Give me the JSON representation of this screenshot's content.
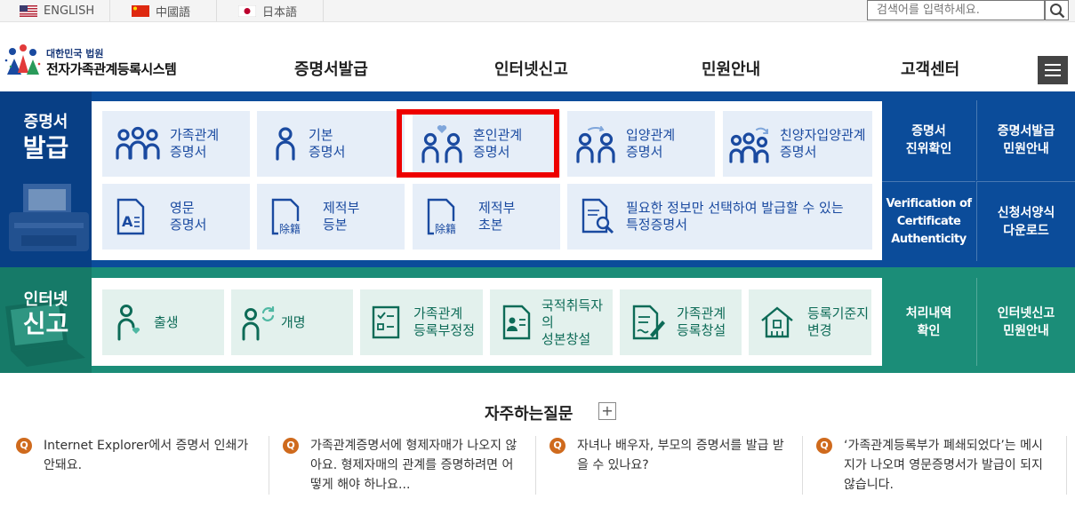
{
  "top_bar": {
    "languages": [
      {
        "label": "ENGLISH"
      },
      {
        "label": "中國語"
      },
      {
        "label": "日本語"
      }
    ],
    "search_placeholder": "검색어를 입력하세요."
  },
  "logo": {
    "sub": "대한민국 법원",
    "main": "전자가족관계등록시스템"
  },
  "gnb": [
    "증명서발급",
    "인터넷신고",
    "민원안내",
    "고객센터"
  ],
  "certificate": {
    "title_small": "증명서",
    "title_large": "발급",
    "tiles": [
      {
        "line1": "가족관계",
        "line2": "증명서",
        "icon": "family-icon"
      },
      {
        "line1": "기본",
        "line2": "증명서",
        "icon": "person-icon"
      },
      {
        "line1": "혼인관계",
        "line2": "증명서",
        "icon": "marriage-icon"
      },
      {
        "line1": "입양관계",
        "line2": "증명서",
        "icon": "adoption-icon"
      },
      {
        "line1": "친양자입양관계",
        "line2": "증명서",
        "icon": "full-adoption-icon"
      },
      {
        "line1": "영문",
        "line2": "증명서",
        "icon": "english-doc-icon"
      },
      {
        "line1": "제적부",
        "line2": "등본",
        "icon": "removed-register-icon"
      },
      {
        "line1": "제적부",
        "line2": "초본",
        "icon": "removed-register-icon"
      },
      {
        "line1": "필요한 정보만 선택하여 발급할 수 있는",
        "line2": "특정증명서",
        "icon": "doc-search-icon"
      }
    ],
    "stamp_text": "除籍",
    "right": [
      {
        "line1": "증명서",
        "line2": "진위확인"
      },
      {
        "line1": "증명서발급",
        "line2": "민원안내"
      },
      {
        "line1": "Verification of",
        "line2": "Certificate",
        "line3": "Authenticity"
      },
      {
        "line1": "신청서양식",
        "line2": "다운로드"
      }
    ]
  },
  "internet_report": {
    "title_small": "인터넷",
    "title_large": "신고",
    "tiles": [
      {
        "line1": "출생",
        "line2": "",
        "icon": "birth-icon"
      },
      {
        "line1": "개명",
        "line2": "",
        "icon": "rename-icon"
      },
      {
        "line1": "가족관계",
        "line2": "등록부정정",
        "icon": "checklist-icon"
      },
      {
        "line1": "국적취득자의",
        "line2": "성본창설",
        "icon": "id-card-icon"
      },
      {
        "line1": "가족관계",
        "line2": "등록창설",
        "icon": "doc-pen-icon"
      },
      {
        "line1": "등록기준지",
        "line2": "변경",
        "icon": "house-icon"
      }
    ],
    "right": [
      {
        "line1": "처리내역",
        "line2": "확인"
      },
      {
        "line1": "인터넷신고",
        "line2": "민원안내"
      }
    ]
  },
  "faq": {
    "title": "자주하는질문",
    "plus": "+",
    "q_badge": "Q",
    "items": [
      {
        "text": "Internet Explorer에서 증명서 인쇄가 안돼요."
      },
      {
        "text": "가족관계증명서에 형제자매가 나오지 않아요. 형제자매의 관계를 증명하려면 어떻게 해야 하나요..."
      },
      {
        "text": "자녀나 배우자, 부모의 증명서를 발급 받을 수 있나요?"
      },
      {
        "text": "‘가족관계등록부가 폐쇄되었다’는 메시지가 나오며 영문증명서가 발급이 되지 않습니다."
      }
    ]
  },
  "colors": {
    "cert_bg": "#0b4c9a",
    "cert_tile": "#e6eef8",
    "net_bg": "#1b8d78",
    "net_tile": "#e3f1ed",
    "highlight": "#ee0000",
    "faq_badge": "#cf6a1d"
  }
}
